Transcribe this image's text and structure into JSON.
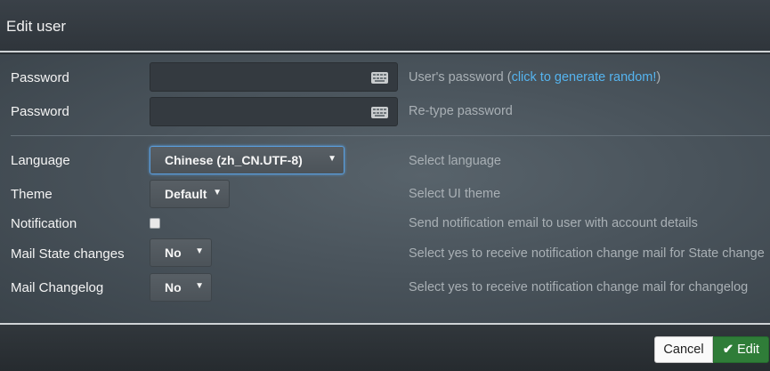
{
  "dialog": {
    "title": "Edit user"
  },
  "form": {
    "password": {
      "label": "Password",
      "help_prefix": "User's password (",
      "help_link": "click to generate random!",
      "help_suffix": ")",
      "icon": "keyboard-icon"
    },
    "password_retype": {
      "label": "Password",
      "help": "Re-type password",
      "icon": "keyboard-icon"
    },
    "language": {
      "label": "Language",
      "value": "Chinese (zh_CN.UTF-8)",
      "help": "Select language"
    },
    "theme": {
      "label": "Theme",
      "value": "Default",
      "help": "Select UI theme"
    },
    "notification": {
      "label": "Notification",
      "checked": false,
      "help": "Send notification email to user with account details"
    },
    "mail_state": {
      "label": "Mail State changes",
      "value": "No",
      "help": "Select yes to receive notification change mail for State change"
    },
    "mail_changelog": {
      "label": "Mail Changelog",
      "value": "No",
      "help": "Select yes to receive notification change mail for changelog"
    }
  },
  "footer": {
    "cancel_label": "Cancel",
    "edit_label": "Edit"
  },
  "colors": {
    "accent": "#55b4ef",
    "primary_button": "#2f7d38",
    "focus_border": "#5a9fdf"
  }
}
